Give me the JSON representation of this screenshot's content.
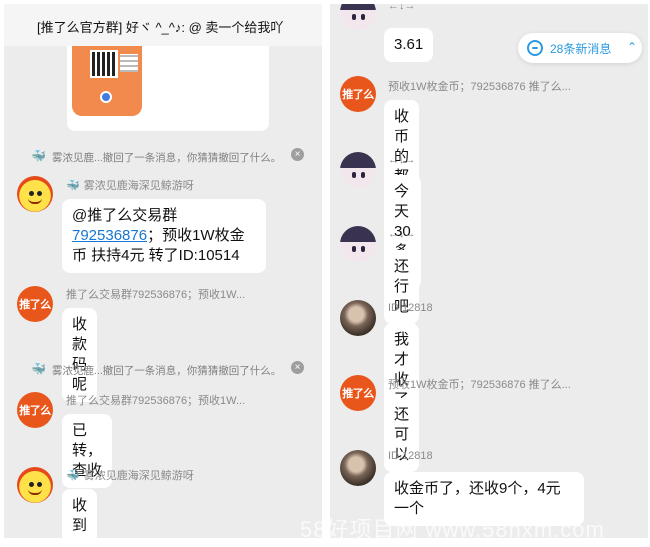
{
  "left": {
    "header": {
      "title": "[推了么官方群] 好ヾ ^_^♪: @ 卖一个给我吖"
    },
    "recall_1": {
      "text": "雾浓见鹿...撤回了一条消息，你猜猜撤回了什么。"
    },
    "msg_1": {
      "sender": "雾浓见鹿海深见鲸游呀",
      "line1": "@推了么交易群",
      "link": "792536876",
      "rest": "；预收1W枚金币 扶持4元 转了ID:10514"
    },
    "msg_2": {
      "sender": "推了么交易群792536876；预收1W...",
      "text": "收款码呢"
    },
    "recall_2": {
      "text": "雾浓见鹿...撤回了一条消息，你猜猜撤回了什么。"
    },
    "msg_3": {
      "sender": "推了么交易群792536876；预收1W...",
      "text": "已转，查收"
    },
    "msg_4": {
      "sender": "雾浓见鹿海深见鲸游呀",
      "text": "收到"
    }
  },
  "right": {
    "msg_1": {
      "sender": "←↓→",
      "text": "3.61"
    },
    "new_messages": {
      "label": "28条新消息"
    },
    "msg_2": {
      "sender": "预收1W枚金币；792536876 推了么...",
      "text": "收币的都收了多少啦"
    },
    "msg_3": {
      "sender": "←↓→",
      "text": "今天30多个"
    },
    "msg_4": {
      "sender": "←↓→",
      "text": "还行吧"
    },
    "msg_5": {
      "sender": "ID:12818",
      "text": "我才收了5个"
    },
    "msg_6": {
      "sender": "预收1W枚金币；792536876 推了么...",
      "text": "还可以"
    },
    "msg_7": {
      "sender": "ID.12818",
      "text": "收金币了，还收9个，4元一个"
    }
  },
  "avatar_text": "推了么",
  "watermark": "58好项目网 www.58hxm.com",
  "colors": {
    "link": "#1677d2",
    "accent": "#2a9be0",
    "brand_orange": "#e8561b",
    "bg": "#ececec"
  },
  "icons": {
    "whale": "whale-icon",
    "close": "close-icon",
    "chat": "chat-icon",
    "chevron": "chevron-up-icon"
  }
}
